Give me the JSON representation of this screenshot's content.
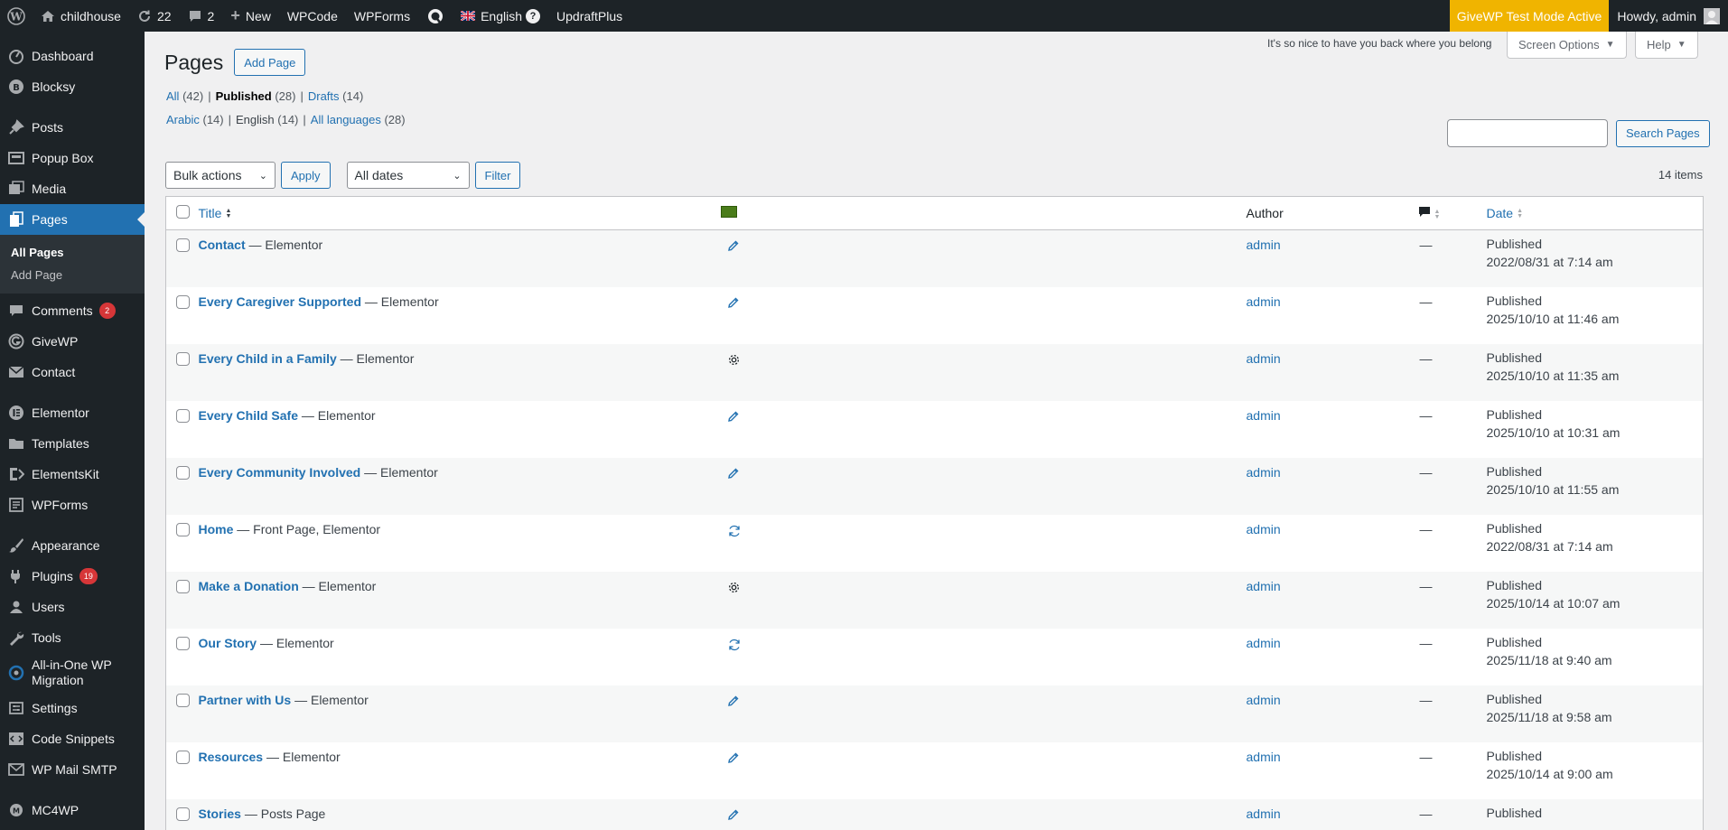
{
  "admin_bar": {
    "site_name": "childhouse",
    "updates_count": "22",
    "comments_count": "2",
    "new_label": "New",
    "wpcode_label": "WPCode",
    "wpforms_label": "WPForms",
    "language_label": "English",
    "updraft_label": "UpdraftPlus",
    "givewp_badge": "GiveWP Test Mode Active",
    "howdy": "Howdy, admin"
  },
  "sidebar": {
    "items": [
      {
        "label": "Dashboard",
        "icon": "dashboard-icon"
      },
      {
        "label": "Blocksy",
        "icon": "blocksy-icon"
      },
      {
        "label": "Posts",
        "icon": "pin-icon"
      },
      {
        "label": "Popup Box",
        "icon": "popup-icon"
      },
      {
        "label": "Media",
        "icon": "media-icon"
      },
      {
        "label": "Pages",
        "icon": "pages-icon"
      },
      {
        "label": "Comments",
        "icon": "comments-icon",
        "badge": "2"
      },
      {
        "label": "GiveWP",
        "icon": "givewp-icon"
      },
      {
        "label": "Contact",
        "icon": "mail-icon"
      },
      {
        "label": "Elementor",
        "icon": "elementor-icon"
      },
      {
        "label": "Templates",
        "icon": "folder-icon"
      },
      {
        "label": "ElementsKit",
        "icon": "elementskit-icon"
      },
      {
        "label": "WPForms",
        "icon": "wpforms-icon"
      },
      {
        "label": "Appearance",
        "icon": "brush-icon"
      },
      {
        "label": "Plugins",
        "icon": "plug-icon",
        "badge": "19"
      },
      {
        "label": "Users",
        "icon": "users-icon"
      },
      {
        "label": "Tools",
        "icon": "wrench-icon"
      },
      {
        "label": "All-in-One WP",
        "label2": "Migration",
        "icon": "migration-icon"
      },
      {
        "label": "Settings",
        "icon": "settings-icon"
      },
      {
        "label": "Code Snippets",
        "icon": "code-icon"
      },
      {
        "label": "WP Mail SMTP",
        "icon": "smtp-icon"
      },
      {
        "label": "MC4WP",
        "icon": "mc4wp-icon"
      }
    ],
    "submenu": [
      "All Pages",
      "Add Page"
    ]
  },
  "page": {
    "title": "Pages",
    "add_button": "Add Page",
    "welcome": "It's so nice to have you back where you belong",
    "screen_options": "Screen Options",
    "help": "Help",
    "status_filters": [
      {
        "label": "All",
        "count": "(42)"
      },
      {
        "label": "Published",
        "count": "(28)"
      },
      {
        "label": "Drafts",
        "count": "(14)"
      }
    ],
    "lang_filters": [
      {
        "label": "Arabic",
        "count": "(14)"
      },
      {
        "label": "English",
        "count": "(14)"
      },
      {
        "label": "All languages",
        "count": "(28)"
      }
    ],
    "search_button": "Search Pages",
    "bulk_actions": "Bulk actions",
    "apply": "Apply",
    "all_dates": "All dates",
    "filter": "Filter",
    "items_count": "14 items"
  },
  "table": {
    "headers": {
      "title": "Title",
      "author": "Author",
      "date": "Date"
    },
    "rows": [
      {
        "title": "Contact",
        "state": " — Elementor",
        "icon": "pencil-icon",
        "author": "admin",
        "comments": "—",
        "status": "Published",
        "date": "2022/08/31 at 7:14 am"
      },
      {
        "title": "Every Caregiver Supported",
        "state": " — Elementor",
        "icon": "pencil-icon",
        "author": "admin",
        "comments": "—",
        "status": "Published",
        "date": "2025/10/10 at 11:46 am"
      },
      {
        "title": "Every Child in a Family",
        "state": " — Elementor",
        "icon": "gear-icon",
        "author": "admin",
        "comments": "—",
        "status": "Published",
        "date": "2025/10/10 at 11:35 am"
      },
      {
        "title": "Every Child Safe",
        "state": " — Elementor",
        "icon": "pencil-icon",
        "author": "admin",
        "comments": "—",
        "status": "Published",
        "date": "2025/10/10 at 10:31 am"
      },
      {
        "title": "Every Community Involved",
        "state": " — Elementor",
        "icon": "pencil-icon",
        "author": "admin",
        "comments": "—",
        "status": "Published",
        "date": "2025/10/10 at 11:55 am"
      },
      {
        "title": "Home",
        "state": " — Front Page, Elementor",
        "icon": "sync-icon",
        "author": "admin",
        "comments": "—",
        "status": "Published",
        "date": "2022/08/31 at 7:14 am"
      },
      {
        "title": "Make a Donation",
        "state": " — Elementor",
        "icon": "gear-icon",
        "author": "admin",
        "comments": "—",
        "status": "Published",
        "date": "2025/10/14 at 10:07 am"
      },
      {
        "title": "Our Story",
        "state": " — Elementor",
        "icon": "sync-icon",
        "author": "admin",
        "comments": "—",
        "status": "Published",
        "date": "2025/11/18 at 9:40 am"
      },
      {
        "title": "Partner with Us",
        "state": " — Elementor",
        "icon": "pencil-icon",
        "author": "admin",
        "comments": "—",
        "status": "Published",
        "date": "2025/11/18 at 9:58 am"
      },
      {
        "title": "Resources",
        "state": " — Elementor",
        "icon": "pencil-icon",
        "author": "admin",
        "comments": "—",
        "status": "Published",
        "date": "2025/10/14 at 9:00 am"
      },
      {
        "title": "Stories",
        "state": " — Posts Page",
        "icon": "pencil-icon",
        "author": "admin",
        "comments": "—",
        "status": "Published",
        "date": ""
      }
    ]
  }
}
